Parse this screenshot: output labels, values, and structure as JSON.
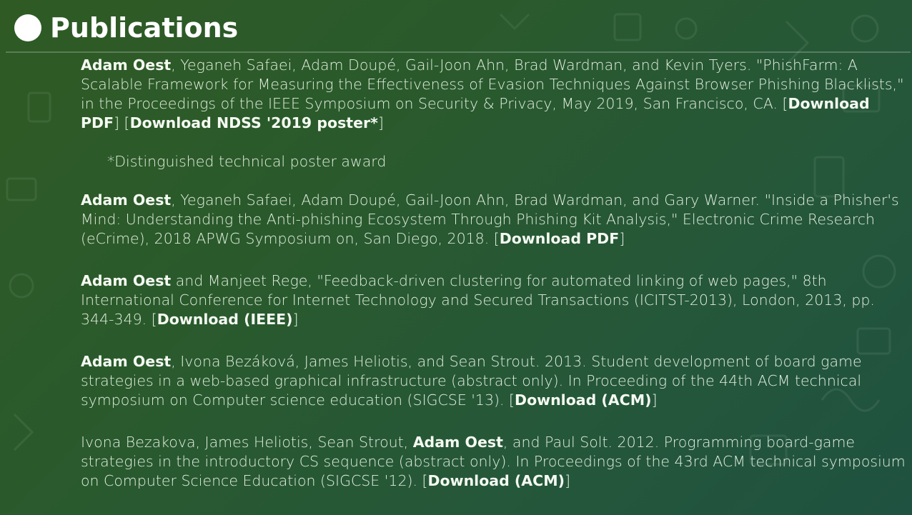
{
  "header": {
    "title": "Publications"
  },
  "publications": [
    {
      "pre": "",
      "bold_author": "Adam Oest",
      "text": ", Yeganeh Safaei, Adam Doupé, Gail-Joon Ahn, Brad Wardman, and Kevin Tyers. \"PhishFarm: A Scalable Framework for Measuring the Effectiveness of Evasion Techniques Against Browser Phishing Blacklists,\" in the Proceedings of the IEEE Symposium on Security & Privacy, May 2019, San Francisco, CA. ",
      "links": [
        {
          "label": "Download PDF"
        },
        {
          "label": "Download NDSS '2019 poster*"
        }
      ],
      "note": "*Distinguished technical poster award"
    },
    {
      "pre": "",
      "bold_author": "Adam Oest",
      "text": ", Yeganeh Safaei, Adam Doupé, Gail-Joon Ahn, Brad Wardman, and Gary Warner. \"Inside a Phisher's Mind: Understanding the Anti-phishing Ecosystem Through Phishing Kit Analysis,\" Electronic Crime Research (eCrime), 2018 APWG Symposium on, San Diego, 2018. ",
      "links": [
        {
          "label": "Download PDF"
        }
      ]
    },
    {
      "pre": "",
      "bold_author": "Adam Oest",
      "text": " and Manjeet Rege, \"Feedback-driven clustering for automated linking of web pages,\" 8th International Conference for Internet Technology and Secured Transactions (ICITST-2013), London, 2013, pp. 344-349. ",
      "links": [
        {
          "label": "Download (IEEE)"
        }
      ]
    },
    {
      "pre": "",
      "bold_author": "Adam Oest",
      "text": ", Ivona Bezáková, James Heliotis, and Sean Strout. 2013. Student development of board game strategies in a web-based graphical infrastructure (abstract only). In Proceeding of the 44th ACM technical symposium on Computer science education (SIGCSE '13). ",
      "links": [
        {
          "label": "Download (ACM)"
        }
      ]
    },
    {
      "pre": "Ivona Bezakova, James Heliotis, Sean Strout, ",
      "bold_author": "Adam Oest",
      "text": ", and Paul Solt. 2012. Programming board-game strategies in the introductory CS sequence (abstract only). In Proceedings of the 43rd ACM technical symposium on Computer Science Education (SIGCSE '12). ",
      "links": [
        {
          "label": "Download (ACM)"
        }
      ]
    }
  ]
}
